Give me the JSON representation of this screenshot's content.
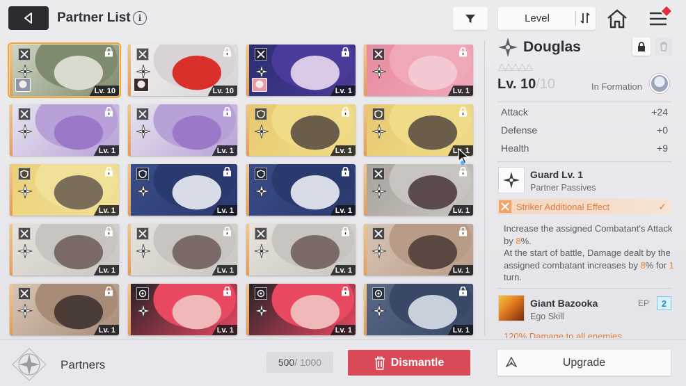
{
  "header": {
    "title": "Partner List",
    "info_icon": "i",
    "sort_label": "Level",
    "icons": [
      "back-arrow-icon",
      "info-icon",
      "filter-icon",
      "sort-icon",
      "home-icon",
      "menu-icon"
    ]
  },
  "colors": {
    "accent_orange": "#e8862c",
    "dismantle_red": "#d84a58",
    "selected_outline": "#f5a623",
    "ep_blue": "#2f8fb0"
  },
  "cards": [
    {
      "level": "Lv. 10",
      "role": "striker",
      "art": [
        "#7e8b6e",
        "#cfd4c4",
        "#d9dbcf"
      ],
      "formation": true,
      "mini": "#8f96a8"
    },
    {
      "level": "Lv. 10",
      "role": "striker",
      "art": [
        "#d8d4d6",
        "#f2efee",
        "#d9302c"
      ],
      "formation": true,
      "mini": "#3a2a28"
    },
    {
      "level": "Lv. 1",
      "role": "striker",
      "art": [
        "#4a3b9a",
        "#2a2d6e",
        "#d9c8e6"
      ],
      "formation": true,
      "mini": "#e89aa8"
    },
    {
      "level": "Lv. 1",
      "role": "striker",
      "art": [
        "#f0a8b8",
        "#e88aa0",
        "#f4c8d0"
      ],
      "formation": false
    },
    {
      "level": "Lv. 1",
      "role": "striker",
      "art": [
        "#b8a0d8",
        "#e8e4ee",
        "#9a7ac8"
      ],
      "formation": false
    },
    {
      "level": "Lv. 1",
      "role": "striker",
      "art": [
        "#b8a0d8",
        "#e8e4ee",
        "#9a7ac8"
      ],
      "formation": false
    },
    {
      "level": "Lv. 1",
      "role": "guard",
      "art": [
        "#f0dc88",
        "#e8c870",
        "#6a5e4a"
      ],
      "formation": false
    },
    {
      "level": "Lv. 1",
      "role": "guard",
      "art": [
        "#f0dc88",
        "#e8c870",
        "#6a5e4a"
      ],
      "formation": false
    },
    {
      "level": "Lv. 1",
      "role": "guard",
      "art": [
        "#f0e098",
        "#ecd078",
        "#7a6e58"
      ],
      "formation": false
    },
    {
      "level": "Lv. 1",
      "role": "guard",
      "art": [
        "#2a3a6e",
        "#3a4c88",
        "#d8dce8"
      ],
      "formation": false
    },
    {
      "level": "Lv. 1",
      "role": "guard",
      "art": [
        "#2a3a6e",
        "#3a4c88",
        "#d8dce8"
      ],
      "formation": false
    },
    {
      "level": "Lv. 1",
      "role": "striker",
      "art": [
        "#c8c4c0",
        "#a8a29c",
        "#5a4a4a"
      ],
      "formation": false
    },
    {
      "level": "Lv. 1",
      "role": "striker",
      "art": [
        "#c8c4c0",
        "#e8e2dc",
        "#7a6a68"
      ],
      "formation": false
    },
    {
      "level": "Lv. 1",
      "role": "striker",
      "art": [
        "#c8c4c0",
        "#e8e2dc",
        "#7a6a68"
      ],
      "formation": false
    },
    {
      "level": "Lv. 1",
      "role": "striker",
      "art": [
        "#c8c4c0",
        "#e8e2dc",
        "#7a6a68"
      ],
      "formation": false
    },
    {
      "level": "Lv. 1",
      "role": "striker",
      "art": [
        "#b89c88",
        "#d8c4b4",
        "#5a4840"
      ],
      "formation": false
    },
    {
      "level": "Lv. 1",
      "role": "striker",
      "art": [
        "#a88c78",
        "#d8c4b4",
        "#4a3c36"
      ],
      "formation": false
    },
    {
      "level": "Lv. 1",
      "role": "special",
      "art": [
        "#e84860",
        "#2a2228",
        "#f0b8b8"
      ],
      "formation": false
    },
    {
      "level": "Lv. 1",
      "role": "special",
      "art": [
        "#e84860",
        "#2a2228",
        "#f0b8b8"
      ],
      "formation": false
    },
    {
      "level": "Lv. 1",
      "role": "special",
      "art": [
        "#3a4868",
        "#5a6888",
        "#c8d0dc"
      ],
      "formation": false
    }
  ],
  "detail": {
    "name": "Douglas",
    "stars": "△△△△△",
    "level_prefix": "Lv. 10",
    "level_max": "/10",
    "formation_text": "In Formation",
    "stats": [
      {
        "label": "Attack",
        "value": "+24"
      },
      {
        "label": "Defense",
        "value": "+0"
      },
      {
        "label": "Health",
        "value": "+9"
      }
    ],
    "passive": {
      "title": "Guard Lv. 1",
      "subtitle": "Partner Passives",
      "effect_label": "Striker Additional Effect",
      "desc_1": "Increase the assigned Combatant's Attack by ",
      "desc_1_pct": "8",
      "desc_1_end": "%.",
      "desc_2": "At the start of battle, Damage dealt by the assigned combatant increases by ",
      "desc_2_pct": "8",
      "desc_2_mid": "% for ",
      "desc_2_turns": "1",
      "desc_2_end": " turn."
    },
    "ego": {
      "title": "Giant Bazooka",
      "subtitle": "Ego Skill",
      "ep_label": "EP",
      "ep_value": "2",
      "desc": "120% Damage to all enemies"
    }
  },
  "footer": {
    "partners_label": "Partners",
    "count": "500",
    "count_max": " / 1000",
    "dismantle_label": "Dismantle",
    "upgrade_label": "Upgrade"
  }
}
